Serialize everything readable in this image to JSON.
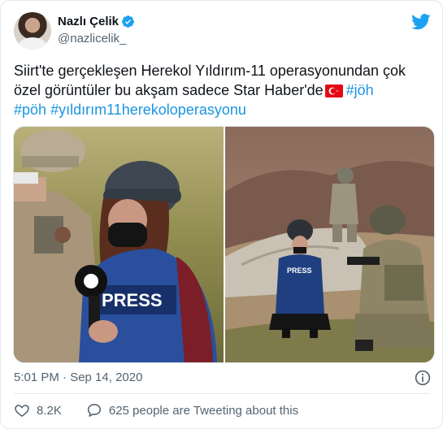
{
  "author": {
    "display_name": "Nazlı Çelik",
    "handle": "@nazlicelik_"
  },
  "tweet": {
    "text_before_flag": "Siirt'te gerçekleşen Herekol Yıldırım-11 operasyonundan çok özel görüntüler bu akşam sadece Star Haber'de",
    "hashtags": [
      "#jöh",
      "#pöh",
      "#yıldırım11herekoloperasyonu"
    ],
    "press_label_left": "PRESS",
    "press_label_right": "PRESS"
  },
  "meta": {
    "timestamp": "5:01 PM · Sep 14, 2020"
  },
  "actions": {
    "like_count": "8.2K",
    "conversation_text": "625 people are Tweeting about this"
  },
  "colors": {
    "link": "#1b95e0",
    "verified": "#1da1f2",
    "flag_red": "#e30a17"
  },
  "icons": {
    "verified": "verified-badge-icon",
    "logo": "twitter-bird-icon",
    "info": "info-icon",
    "like": "heart-icon",
    "reply": "speech-bubble-icon"
  }
}
